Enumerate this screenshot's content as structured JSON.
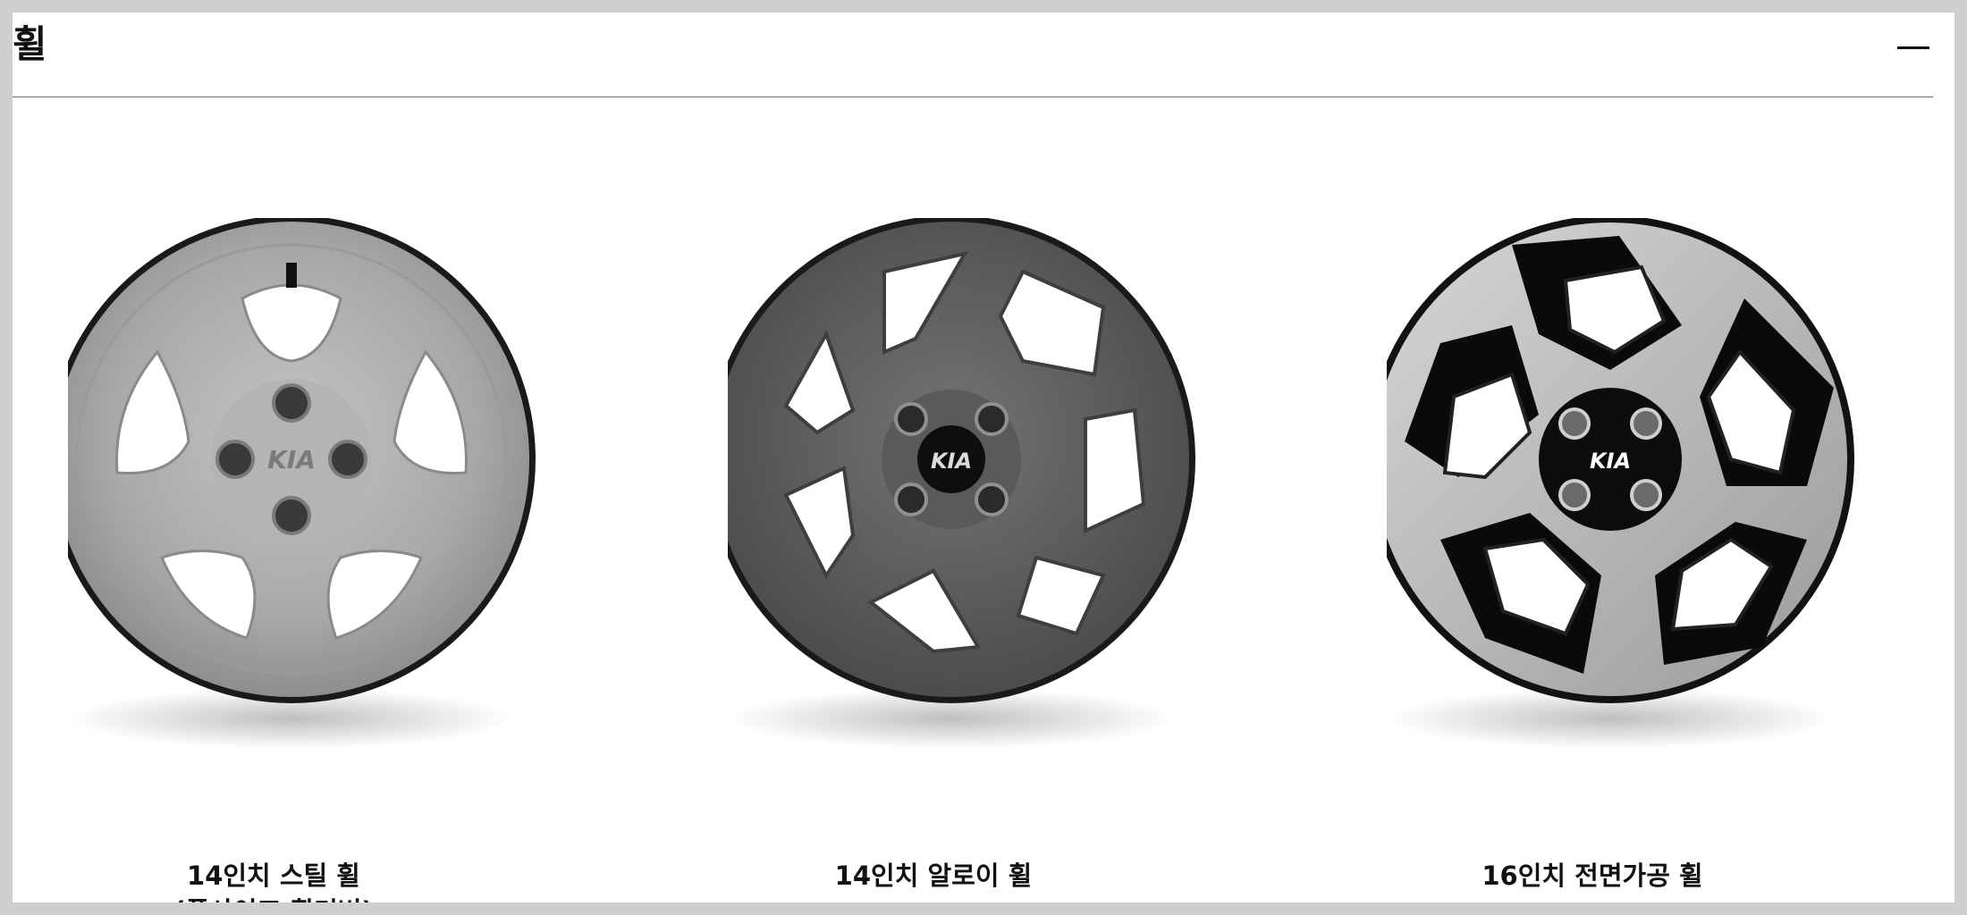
{
  "section": {
    "title": "휠",
    "collapse_icon": "minus-icon"
  },
  "wheels": [
    {
      "name_line1": "14인치 스틸 휠",
      "name_line2": "(풀사이즈 휠커버)",
      "image": "wheel-steel-silver-icon"
    },
    {
      "name_line1": "14인치 알로이 휠",
      "name_line2": "",
      "image": "wheel-alloy-gray-icon"
    },
    {
      "name_line1": "16인치 전면가공 휠",
      "name_line2": "",
      "image": "wheel-machined-black-icon"
    }
  ],
  "colors": {
    "steel": "#a9a9a9",
    "alloy": "#5b5b5b",
    "machined_black": "#0b0b0b",
    "machined_face": "#bdbdbd"
  }
}
